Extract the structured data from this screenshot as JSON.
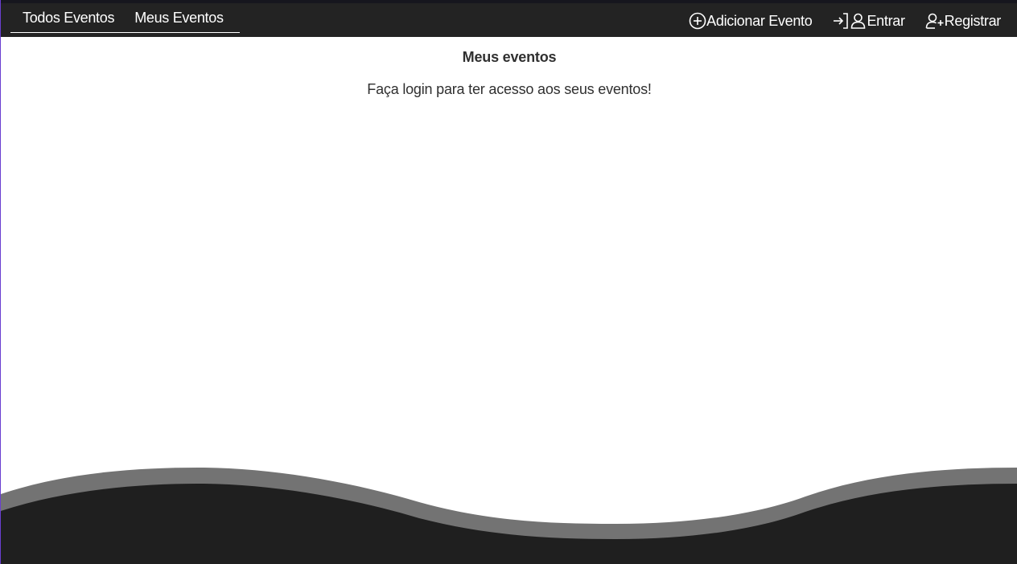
{
  "navbar": {
    "left_links": [
      {
        "label": "Todos Eventos"
      },
      {
        "label": "Meus Eventos"
      }
    ],
    "add_event": {
      "label": "Adicionar Evento",
      "icon": "plus-circle-icon"
    },
    "login": {
      "label": "Entrar",
      "icons": [
        "sign-in-arrow-icon",
        "user-icon"
      ]
    },
    "register": {
      "label": "Registrar",
      "icon": "user-plus-icon"
    }
  },
  "main": {
    "title": "Meus eventos",
    "message": "Faça login para ter acesso aos seus eventos!"
  },
  "colors": {
    "navbar_bg": "#232323",
    "wave_light": "#737373",
    "wave_dark": "#1f1f1f",
    "text": "#303030"
  }
}
